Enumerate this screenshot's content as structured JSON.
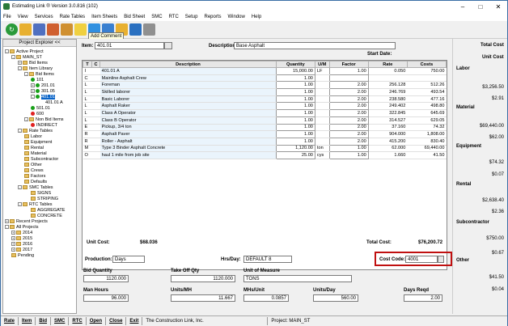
{
  "window": {
    "title": "Estimating Link ® Version  3.0.816 (102)"
  },
  "menu": [
    "File",
    "View",
    "Services",
    "Rate Tables",
    "Item Sheets",
    "Bid Sheet",
    "SMC",
    "RTC",
    "Setup",
    "Reports",
    "Window",
    "Help"
  ],
  "tooltip": "Add Comment",
  "explorer": {
    "title": "Project Explorer <<",
    "nodes": [
      "Active Project",
      "MAIN_ST",
      "Bid Items",
      "Item Library",
      "Bid Items",
      "101",
      "201.01",
      "301.05",
      "401.01",
      "401.01 A",
      "501.01",
      "600",
      "Non Bid Items",
      "INDIRECT",
      "Rate Tables",
      "Labor",
      "Equipment",
      "Rental",
      "Material",
      "Subcontractor",
      "Other",
      "Crews",
      "Factors",
      "Defaults",
      "SMC Tables",
      "SIGNS",
      "STRIPING",
      "RTC Tables",
      "AGGREGATE",
      "CONCRETE",
      "Recent Projects",
      "All Projects",
      "2014",
      "2015",
      "2016",
      "2017",
      "Pending"
    ]
  },
  "header": {
    "item_label": "Item:",
    "item_value": "401.01",
    "desc_label": "Description:",
    "desc_value": "Base Asphalt",
    "start_date_label": "Start Date:"
  },
  "grid": {
    "columns": [
      "T",
      "C",
      "Description",
      "Quantity",
      "U/M",
      "Factor",
      "Rate",
      "Costs"
    ],
    "rows": [
      [
        "I",
        "",
        "401.01 A",
        "15,000.00",
        "LF",
        "1.00",
        "0.050",
        "750.00"
      ],
      [
        "C",
        "",
        "Mainline Asphalt Crew",
        "1.00",
        "",
        "",
        "",
        ""
      ],
      [
        "L",
        "",
        "Foreman",
        "1.00",
        "",
        "2.00",
        "256.128",
        "512.26"
      ],
      [
        "L",
        "",
        "Skilled laborer",
        "1.00",
        "",
        "2.00",
        "246.769",
        "493.54"
      ],
      [
        "L",
        "",
        "Basic Laborer",
        "1.00",
        "",
        "2.00",
        "238.580",
        "477.16"
      ],
      [
        "L",
        "",
        "Asphalt Raker",
        "1.00",
        "",
        "2.00",
        "249.402",
        "498.80"
      ],
      [
        "L",
        "",
        "Class A Operator",
        "1.00",
        "",
        "2.00",
        "322.845",
        "645.69"
      ],
      [
        "L",
        "",
        "Class B Operator",
        "1.00",
        "",
        "2.00",
        "314.527",
        "629.05"
      ],
      [
        "E",
        "",
        "Pickup, 3/4 ton",
        "1.00",
        "",
        "2.00",
        "37.160",
        "74.32"
      ],
      [
        "R",
        "",
        "Asphalt Paver",
        "1.00",
        "",
        "2.00",
        "904.000",
        "1,808.00"
      ],
      [
        "R",
        "",
        "Roller - Asphalt",
        "1.00",
        "",
        "2.00",
        "415.200",
        "830.40"
      ],
      [
        "M",
        "",
        "Type 3 Binder Asphalt Concrete",
        "1,120.00",
        "ton",
        "1.00",
        "62.000",
        "69,440.00"
      ],
      [
        "O",
        "",
        "haul 1 mile from job site",
        "25.00",
        "cys",
        "1.00",
        "1.660",
        "41.50"
      ]
    ]
  },
  "summary": {
    "unit_cost_label": "Unit Cost:",
    "unit_cost": "$68.036",
    "total_cost_label": "Total Cost:",
    "total_cost": "$76,200.72",
    "production_label": "Production:",
    "production": "Days",
    "hrs_label": "Hrs/Day:",
    "hrs": "DEFAULT  8",
    "cost_code_label": "Cost Code:",
    "cost_code": "4001",
    "bid_qty_label": "Bid Quantity",
    "bid_qty": "1120.000",
    "takeoff_label": "Take Off Qty",
    "takeoff": "1120.000",
    "uom_label": "Unit of Measure",
    "uom": "TONS",
    "man_hours_label": "Man Hours",
    "man_hours": "96.000",
    "units_mh_label": "Units/MH",
    "units_mh": "11.667",
    "mhs_unit_label": "MHs/Unit",
    "mhs_unit": "0.0857",
    "units_day_label": "Units/Day",
    "units_day": "560.00",
    "days_label": "Days Reqd",
    "days": "2.00"
  },
  "right_pane": {
    "total_cost_label": "Total Cost",
    "unit_cost_label": "Unit Cost",
    "groups": [
      {
        "name": "Labor",
        "total": "$3,256.50",
        "unit": "$2.91"
      },
      {
        "name": "Material",
        "total": "$69,440.00",
        "unit": "$62.00"
      },
      {
        "name": "Equipment",
        "total": "$74.32",
        "unit": "$0.07"
      },
      {
        "name": "Rental",
        "total": "$2,638.40",
        "unit": "$2.36"
      },
      {
        "name": "Subcontractor",
        "total": "$750.00",
        "unit": "$0.67"
      },
      {
        "name": "Other",
        "total": "$41.50",
        "unit": "$0.04"
      }
    ]
  },
  "bottom": {
    "buttons": [
      "Rate",
      "Item",
      "Bid",
      "SMC",
      "RTC",
      "Open",
      "Close",
      "Exit"
    ],
    "company": "The Construction Link, Inc.",
    "project": "Project: MAIN_ST"
  }
}
